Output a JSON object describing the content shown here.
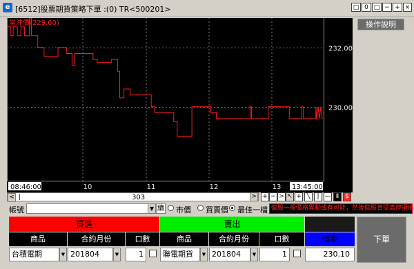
{
  "window": {
    "title": "[6512]股票期貨策略下單 :(0) TR<500201>",
    "controls": [
      "□",
      "0",
      "□",
      "−",
      "+",
      "×"
    ]
  },
  "chart": {
    "legend": "當沖價(229.60)",
    "right_labels": [
      "232.00",
      "230.00"
    ],
    "x_labels": [
      "08:46:00",
      "10",
      "11",
      "12",
      "13",
      "13:45:00"
    ],
    "line_color": "#ff1a1a",
    "help_label": "操作說明"
  },
  "chart_data": {
    "type": "line",
    "title": "當沖價(229.60)",
    "ylim": [
      227.5,
      233.0
    ],
    "y_ticks": [
      232.0,
      230.0
    ],
    "x_ticks": [
      "08:46:00",
      "10",
      "11",
      "12",
      "13",
      "13:45:00"
    ],
    "series": [
      {
        "name": "當沖價",
        "points": [
          [
            0,
            232.7
          ],
          [
            4,
            232.7
          ],
          [
            4,
            232.4
          ],
          [
            8,
            232.4
          ],
          [
            8,
            232.7
          ],
          [
            14,
            232.7
          ],
          [
            14,
            232.4
          ],
          [
            19,
            232.4
          ],
          [
            19,
            232.7
          ],
          [
            24,
            232.7
          ],
          [
            24,
            232.4
          ],
          [
            31,
            232.4
          ],
          [
            31,
            233.0
          ],
          [
            34,
            233.0
          ],
          [
            34,
            232.4
          ],
          [
            43,
            232.4
          ],
          [
            43,
            232.0
          ],
          [
            52,
            232.0
          ],
          [
            52,
            231.7
          ],
          [
            72,
            231.7
          ],
          [
            72,
            232.0
          ],
          [
            84,
            232.0
          ],
          [
            84,
            231.8
          ],
          [
            92,
            231.8
          ],
          [
            92,
            231.4
          ],
          [
            96,
            231.4
          ],
          [
            96,
            231.8
          ],
          [
            122,
            231.8
          ],
          [
            122,
            231.6
          ],
          [
            128,
            231.6
          ],
          [
            128,
            231.5
          ],
          [
            148,
            231.5
          ],
          [
            148,
            231.6
          ],
          [
            157,
            231.6
          ],
          [
            157,
            231.2
          ],
          [
            160,
            231.2
          ],
          [
            160,
            230.3
          ],
          [
            166,
            230.3
          ],
          [
            166,
            230.6
          ],
          [
            175,
            230.6
          ],
          [
            175,
            230.4
          ],
          [
            205,
            230.4
          ],
          [
            205,
            230.0
          ],
          [
            210,
            230.0
          ],
          [
            210,
            229.8
          ],
          [
            237,
            229.8
          ],
          [
            237,
            229.5
          ],
          [
            242,
            229.5
          ],
          [
            242,
            229.0
          ],
          [
            263,
            229.0
          ],
          [
            263,
            230.0
          ],
          [
            290,
            230.0
          ],
          [
            290,
            229.8
          ],
          [
            298,
            229.8
          ],
          [
            298,
            229.6
          ],
          [
            346,
            229.6
          ],
          [
            346,
            230.0
          ],
          [
            348,
            230.0
          ],
          [
            348,
            229.6
          ],
          [
            372,
            229.6
          ],
          [
            372,
            230.0
          ],
          [
            402,
            230.0
          ],
          [
            402,
            229.6
          ],
          [
            420,
            229.6
          ],
          [
            420,
            230.0
          ],
          [
            422,
            230.0
          ],
          [
            422,
            229.6
          ],
          [
            440,
            229.6
          ],
          [
            440,
            230.0
          ],
          [
            441,
            229.6
          ],
          [
            443,
            230.0
          ],
          [
            445,
            229.6
          ],
          [
            447,
            230.0
          ],
          [
            449,
            229.6
          ],
          [
            450,
            229.6
          ]
        ]
      }
    ],
    "x_max": 450
  },
  "scrollbar": {
    "value": "303"
  },
  "tools": [
    "<",
    "|",
    ">",
    "+",
    "−",
    ">",
    "↖",
    "+",
    "╲",
    "|",
    "—",
    "Ⅱ",
    "$"
  ],
  "account": {
    "label": "帳號",
    "value": "",
    "drop": "▼",
    "btn": "續"
  },
  "price_mode": [
    {
      "label": "市價",
      "selected": false
    },
    {
      "label": "買賣價",
      "selected": false
    },
    {
      "label": "最佳一檔",
      "selected": true
    }
  ],
  "warning": "個股一般價格異動或有可能，然後個股資提高停損機",
  "order": {
    "buy_label": "買進",
    "sell_label": "賣出",
    "submit_label": "下單",
    "headers": [
      "商品",
      "合約月份",
      "口數",
      "商品",
      "合約月份",
      "口數",
      "價差"
    ],
    "buy_product": "台積電期",
    "buy_month": "201804",
    "buy_qty": "1",
    "sell_product": "聯電期貨",
    "sell_month": "201804",
    "sell_qty": "1",
    "spread": "230.10"
  },
  "colors": {
    "buy": "#ff0000",
    "sell": "#00ee00",
    "spread": "#0000ff",
    "line": "#ff1a1a"
  }
}
